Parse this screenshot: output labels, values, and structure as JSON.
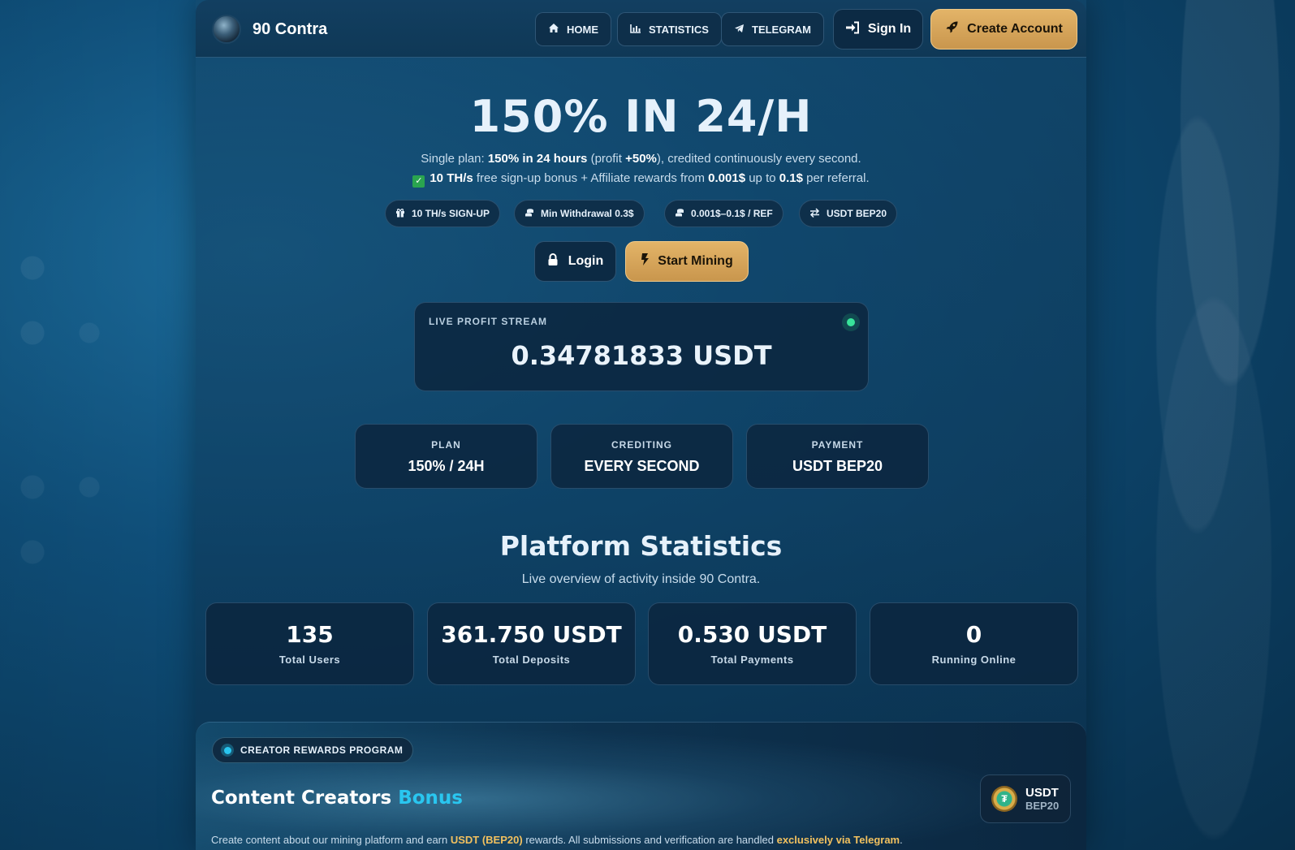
{
  "header": {
    "brand_name": "90 Contra",
    "nav": [
      {
        "label": "HOME",
        "icon": "home-icon"
      },
      {
        "label": "STATISTICS",
        "icon": "chart-icon"
      },
      {
        "label": "TELEGRAM",
        "icon": "telegram-icon"
      }
    ],
    "sign_in_label": "Sign In",
    "create_account_label": "Create Account"
  },
  "hero": {
    "title": "150% IN 24/H",
    "line1": {
      "a": "Single plan: ",
      "b": "150% in 24 hours",
      "c": " (profit ",
      "d": "+50%",
      "e": "), credited continuously every second."
    },
    "line2": {
      "a": "10 TH/s",
      "b": " free sign-up bonus + Affiliate rewards from ",
      "c": "0.001$",
      "d": " up to ",
      "e": "0.1$",
      "f": " per referral."
    },
    "pills": [
      {
        "label": "10 TH/s SIGN-UP",
        "icon": "gift-icon"
      },
      {
        "label": "Min Withdrawal 0.3$",
        "icon": "coins-icon"
      },
      {
        "label": "0.001$–0.1$ / REF",
        "icon": "coins-icon"
      },
      {
        "label": "USDT BEP20",
        "icon": "exchange-icon"
      }
    ],
    "login_label": "Login",
    "start_mining_label": "Start Mining"
  },
  "live": {
    "label": "LIVE PROFIT STREAM",
    "value": "0.34781833 USDT"
  },
  "info": [
    {
      "label": "PLAN",
      "value": "150% / 24H"
    },
    {
      "label": "CREDITING",
      "value": "EVERY SECOND"
    },
    {
      "label": "PAYMENT",
      "value": "USDT BEP20"
    }
  ],
  "stats": {
    "title": "Platform Statistics",
    "subtitle": "Live overview of activity inside 90 Contra.",
    "items": [
      {
        "value": "135",
        "label": "Total Users"
      },
      {
        "value": "361.750 USDT",
        "label": "Total Deposits"
      },
      {
        "value": "0.530 USDT",
        "label": "Total Payments"
      },
      {
        "value": "0",
        "label": "Running Online"
      }
    ]
  },
  "creator": {
    "badge": "CREATOR REWARDS PROGRAM",
    "title_main": "Content Creators ",
    "title_accent": "Bonus",
    "text": {
      "a": "Create content about our mining platform and earn ",
      "b": "USDT (BEP20)",
      "c": " rewards. All submissions and verification are handled ",
      "d": "exclusively via Telegram",
      "e": "."
    },
    "chip_line1": "USDT",
    "chip_line2": "BEP20",
    "coin_symbol": "₮"
  },
  "colors": {
    "accent_gold": "#e3b468",
    "accent_cyan": "#29c6f0",
    "live_green": "#38e39a"
  }
}
